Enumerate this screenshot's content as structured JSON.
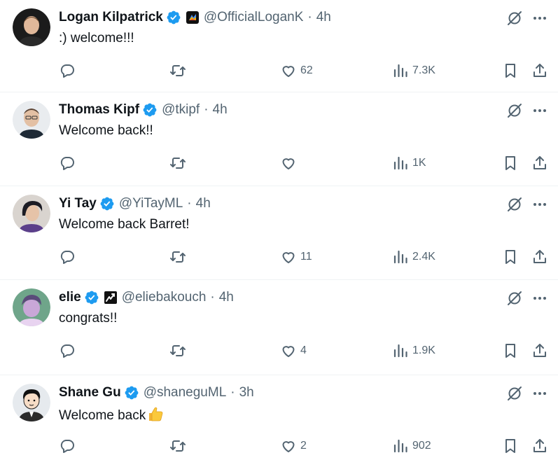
{
  "tweets": [
    {
      "name": "Logan Kilpatrick",
      "handle": "@OfficialLoganK",
      "time": "4h",
      "text": ":) welcome!!!",
      "avatar_icon": "person-photo",
      "affiliation_icon": "affiliate-badge",
      "counts": {
        "replies": "",
        "retweets": "",
        "likes": "62",
        "views": "7.3K"
      }
    },
    {
      "name": "Thomas Kipf",
      "handle": "@tkipf",
      "time": "4h",
      "text": "Welcome back!!",
      "avatar_icon": "person-photo",
      "counts": {
        "replies": "",
        "retweets": "",
        "likes": "",
        "views": "1K"
      }
    },
    {
      "name": "Yi Tay",
      "handle": "@YiTayML",
      "time": "4h",
      "text": "Welcome back Barret!",
      "avatar_icon": "person-photo",
      "counts": {
        "replies": "",
        "retweets": "",
        "likes": "11",
        "views": "2.4K"
      }
    },
    {
      "name": "elie",
      "handle": "@eliebakouch",
      "time": "4h",
      "text": "congrats!!",
      "avatar_icon": "person-photo",
      "affiliation_icon": "affiliate-badge",
      "counts": {
        "replies": "",
        "retweets": "",
        "likes": "4",
        "views": "1.9K"
      }
    },
    {
      "name": "Shane Gu",
      "handle": "@shaneguML",
      "time": "3h",
      "text": "Welcome back",
      "text_emoji": "thumbs-up-emoji",
      "avatar_icon": "cartoon-avatar",
      "counts": {
        "replies": "",
        "retweets": "",
        "likes": "2",
        "views": "902"
      }
    }
  ],
  "colors": {
    "text_primary": "#0f1419",
    "text_secondary": "#536471",
    "verified_blue": "#1d9bf0",
    "divider": "#eff3f4"
  },
  "icons": [
    "verified-badge-icon",
    "grok-icon",
    "more-icon",
    "reply-icon",
    "retweet-icon",
    "like-icon",
    "views-icon",
    "bookmark-icon",
    "share-icon"
  ]
}
